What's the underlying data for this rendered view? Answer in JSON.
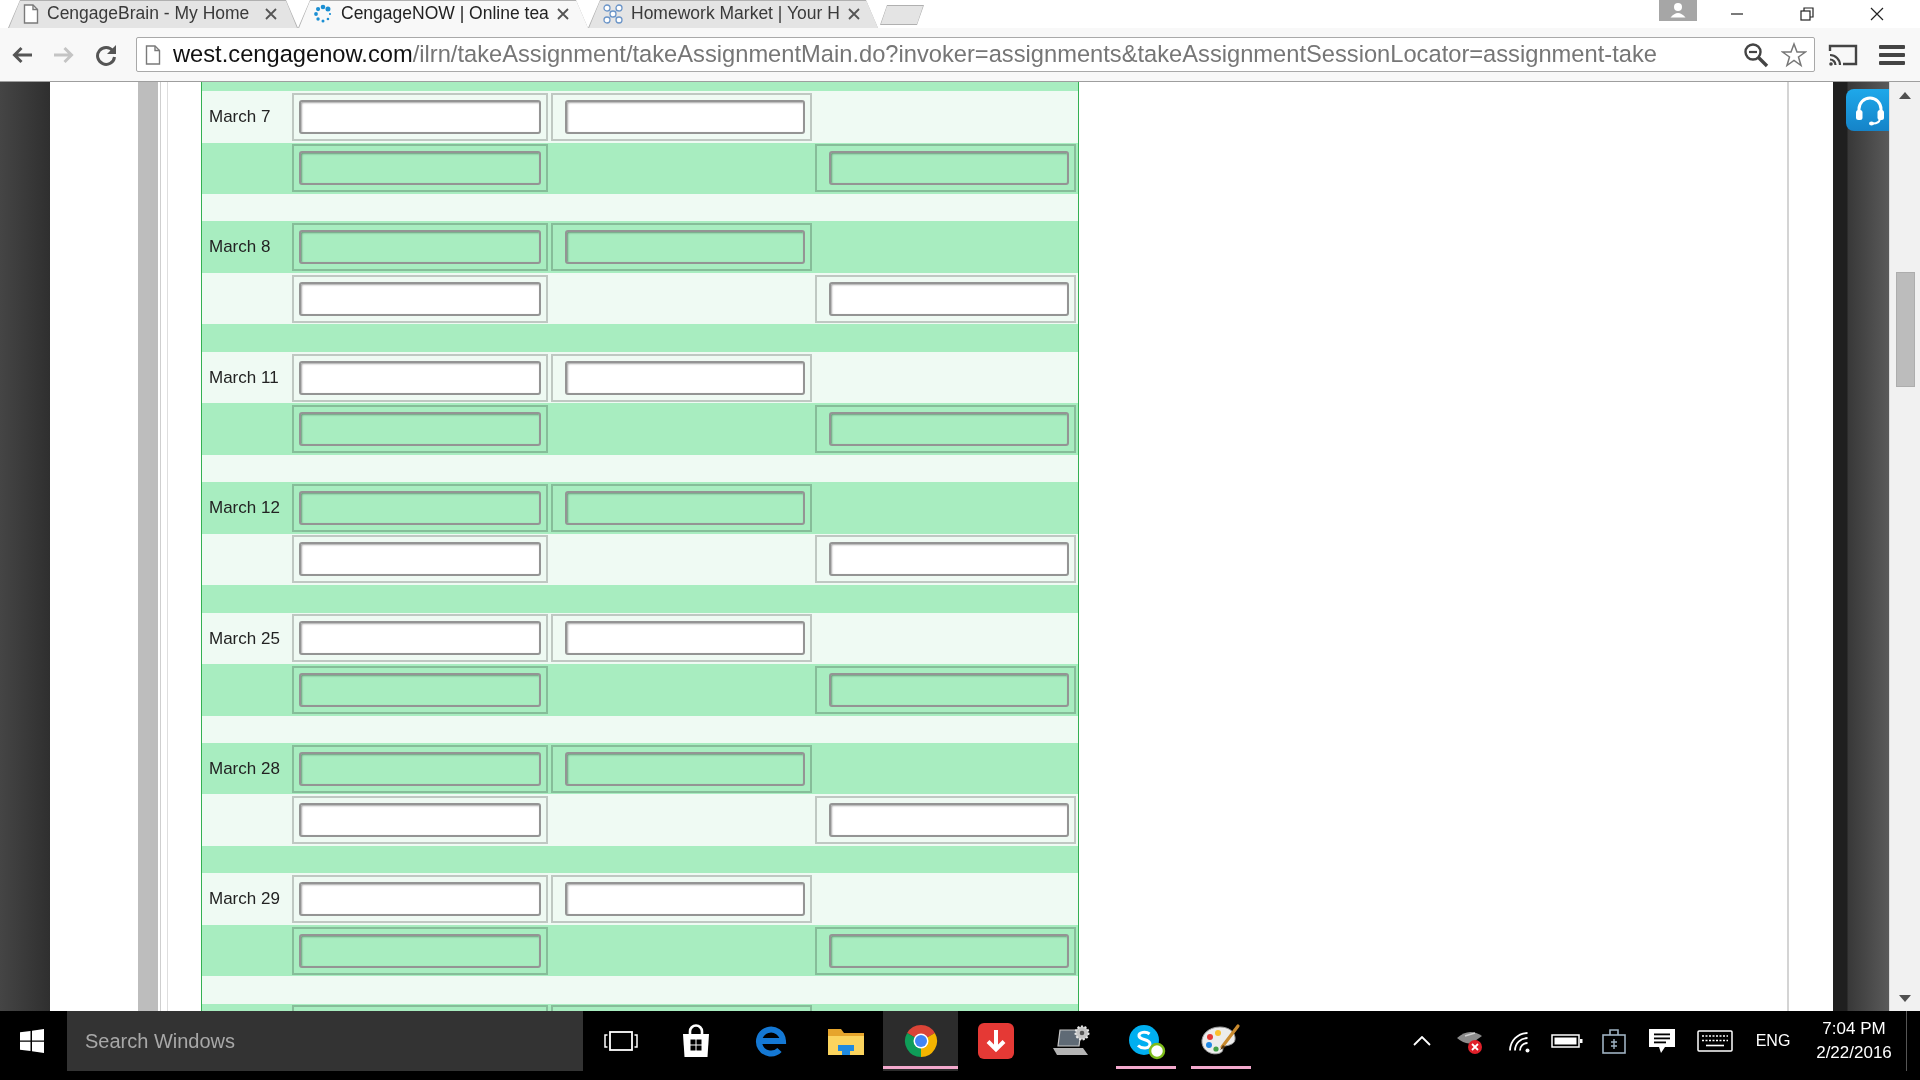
{
  "browser": {
    "tabs": [
      {
        "kind": "document",
        "title": "CengageBrain - My Home",
        "selected": false
      },
      {
        "kind": "spinner",
        "title": "CengageNOW | Online tea",
        "selected": true
      },
      {
        "kind": "network",
        "title": "Homework Market | Your H",
        "selected": false
      }
    ],
    "nav_buttons": [
      {
        "kind": "back",
        "disabled": false
      },
      {
        "kind": "forward",
        "disabled": true
      },
      {
        "kind": "reload",
        "disabled": false
      }
    ],
    "address": {
      "host": "west.cengagenow.com",
      "path": "/ilrn/takeAssignment/takeAssignmentMain.do?invoker=assignments&takeAssignmentSessionLocator=assignment-take"
    }
  },
  "assignment": {
    "rows": [
      {
        "date": "March 7"
      },
      {
        "date": "March 8"
      },
      {
        "date": "March 11"
      },
      {
        "date": "March 12"
      },
      {
        "date": "March 25"
      },
      {
        "date": "March 28"
      },
      {
        "date": "March 29"
      }
    ]
  },
  "taskbar": {
    "search": {
      "placeholder": "Search Windows"
    },
    "apps": [
      {
        "kind": "task-view",
        "open": false,
        "selected": false
      },
      {
        "kind": "bag",
        "open": false,
        "selected": false
      },
      {
        "kind": "e-logo",
        "open": false,
        "selected": false
      },
      {
        "kind": "folder",
        "open": false,
        "selected": false
      },
      {
        "kind": "wheel",
        "open": true,
        "selected": true
      },
      {
        "kind": "arrow-tile",
        "open": false,
        "selected": false
      },
      {
        "kind": "laptop-gear",
        "open": false,
        "selected": false
      },
      {
        "kind": "s-cloud",
        "open": true,
        "selected": false
      },
      {
        "kind": "palette",
        "open": true,
        "selected": false
      }
    ],
    "language": "ENG",
    "clock": {
      "time": "7:04 PM",
      "date": "2/22/2016"
    }
  }
}
